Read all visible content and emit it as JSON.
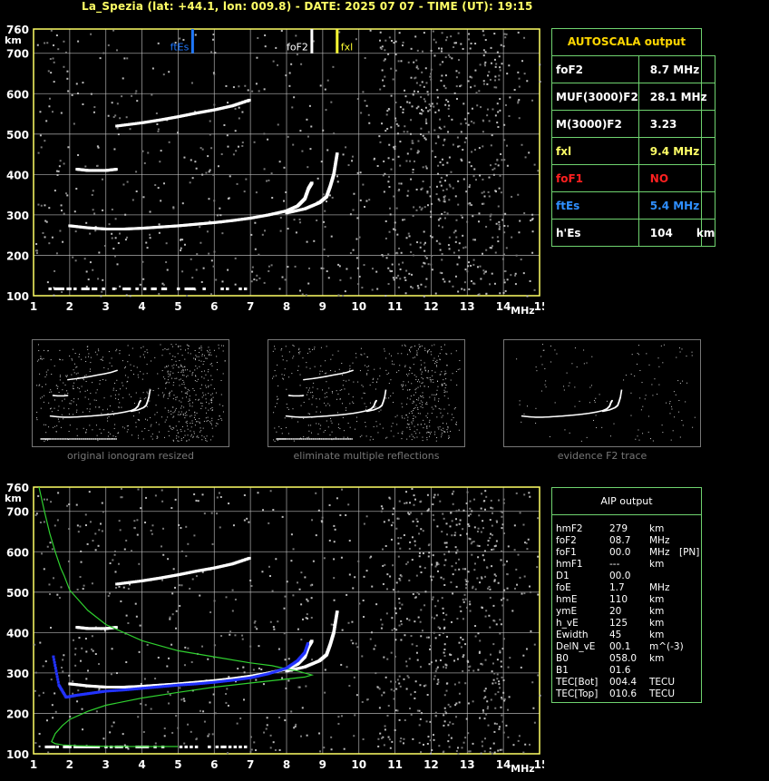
{
  "header": {
    "title": "La_Spezia (lat: +44.1, lon: 009.8) - DATE: 2025 07 07 - TIME (UT): 19:15"
  },
  "axis": {
    "y_unit": "km",
    "x_unit": "MHz",
    "y_ticks": [
      "760",
      "700",
      "600",
      "500",
      "400",
      "300",
      "200",
      "100"
    ],
    "x_ticks": [
      "1",
      "2",
      "3",
      "4",
      "5",
      "6",
      "7",
      "8",
      "9",
      "10",
      "11",
      "12",
      "13",
      "14",
      "15"
    ]
  },
  "markers": {
    "ftEs_label": "ftEs",
    "foF2_label": "foF2",
    "fxl_label": "fxl"
  },
  "autoscala": {
    "title": "AUTOSCALA output",
    "rows": [
      {
        "label": "foF2",
        "value": "8.7 MHz",
        "color": "#ffffff"
      },
      {
        "label": "MUF(3000)F2",
        "value": "28.1 MHz",
        "color": "#ffffff"
      },
      {
        "label": "M(3000)F2",
        "value": "3.23",
        "color": "#ffffff"
      },
      {
        "label": "fxl",
        "value": "9.4 MHz",
        "color": "#ffff66"
      },
      {
        "label": "foF1",
        "value": "NO",
        "color": "#ff2020"
      },
      {
        "label": "ftEs",
        "value": "5.4 MHz",
        "color": "#2f8fff"
      },
      {
        "label": "h'Es",
        "value": "104",
        "unit": "km",
        "color": "#ffffff"
      }
    ]
  },
  "thumbnails": [
    {
      "caption": "original ionogram resized"
    },
    {
      "caption": "eliminate multiple reflections"
    },
    {
      "caption": "evidence F2 trace"
    }
  ],
  "aip": {
    "title": "AIP output",
    "rows": [
      {
        "name": "hmF2",
        "value": "279",
        "unit": "km",
        "extra": ""
      },
      {
        "name": "foF2",
        "value": "08.7",
        "unit": "MHz",
        "extra": ""
      },
      {
        "name": "foF1",
        "value": "00.0",
        "unit": "MHz",
        "extra": "[PN]"
      },
      {
        "name": "hmF1",
        "value": "---",
        "unit": "km",
        "extra": ""
      },
      {
        "name": "D1",
        "value": "00.0",
        "unit": "",
        "extra": ""
      },
      {
        "name": "foE",
        "value": "1.7",
        "unit": "MHz",
        "extra": ""
      },
      {
        "name": "hmE",
        "value": "110",
        "unit": "km",
        "extra": ""
      },
      {
        "name": "ymE",
        "value": "20",
        "unit": "km",
        "extra": ""
      },
      {
        "name": "h_vE",
        "value": "125",
        "unit": "km",
        "extra": ""
      },
      {
        "name": "Ewidth",
        "value": "45",
        "unit": "km",
        "extra": ""
      },
      {
        "name": "DelN_vE",
        "value": "00.1",
        "unit": "m^(-3)",
        "extra": ""
      },
      {
        "name": "B0",
        "value": "058.0",
        "unit": "km",
        "extra": ""
      },
      {
        "name": "B1",
        "value": "01.6",
        "unit": "",
        "extra": ""
      },
      {
        "name": "TEC[Bot]",
        "value": "004.4",
        "unit": "TECU",
        "extra": ""
      },
      {
        "name": "TEC[Top]",
        "value": "010.6",
        "unit": "TECU",
        "extra": ""
      }
    ]
  },
  "colors": {
    "grid": "#c8c8c8",
    "axis": "#ffff66",
    "ftEs": "#1f78ff",
    "fxl": "#ffff33",
    "profile": "#2fd02f",
    "fit": "#2233ff",
    "panel_border": "#6fd36f"
  },
  "chart_data": [
    {
      "type": "scatter",
      "title": "",
      "xlabel": "MHz",
      "ylabel": "km",
      "xlim": [
        1,
        15
      ],
      "ylim": [
        100,
        760
      ],
      "grid": true,
      "series": [
        {
          "name": "",
          "x": [
            2.0,
            2.5,
            3.0,
            3.5,
            4.0,
            4.5,
            5.0,
            5.5,
            6.0,
            6.5,
            7.0,
            7.5,
            8.0,
            8.3,
            8.5,
            8.6,
            8.7
          ],
          "y": [
            273,
            268,
            265,
            265,
            267,
            270,
            273,
            277,
            281,
            286,
            292,
            300,
            310,
            322,
            340,
            365,
            380
          ]
        },
        {
          "name": "",
          "x": [
            8.0,
            8.5,
            8.9,
            9.1,
            9.2,
            9.3,
            9.4
          ],
          "y": [
            305,
            315,
            330,
            345,
            370,
            400,
            455
          ]
        },
        {
          "name": "",
          "x": [
            3.3,
            4.0,
            4.5,
            5.0,
            5.5,
            6.0,
            6.5,
            7.0
          ],
          "y": [
            520,
            528,
            535,
            543,
            552,
            560,
            570,
            585
          ]
        },
        {
          "name": "",
          "x": [
            2.2,
            2.5,
            3.0,
            3.3
          ],
          "y": [
            413,
            410,
            410,
            413
          ]
        },
        {
          "name": "",
          "x": [
            1.3,
            2.0,
            3.0,
            4.0,
            5.0,
            6.0,
            7.0
          ],
          "y": [
            117,
            117,
            117,
            117,
            117,
            117,
            117
          ]
        }
      ],
      "markers": [
        {
          "label": "ftEs",
          "x": 5.4
        },
        {
          "label": "foF2",
          "x": 8.7
        },
        {
          "label": "fxl",
          "x": 9.4
        }
      ]
    },
    {
      "type": "line",
      "title": "",
      "xlabel": "MHz",
      "ylabel": "km",
      "xlim": [
        1,
        15
      ],
      "ylim": [
        100,
        760
      ],
      "grid": true,
      "series": [
        {
          "name": "",
          "x": [
            1.15,
            1.3,
            1.45,
            1.6,
            1.75,
            1.85,
            2.0,
            2.5,
            3.0,
            4.0,
            5.0,
            6.0,
            7.0,
            7.6,
            8.0,
            8.3,
            8.5,
            8.7,
            8.5,
            8.0,
            7.0,
            6.0,
            5.0,
            4.0,
            3.0,
            2.5,
            2.0,
            1.8,
            1.6,
            1.5,
            1.6,
            1.8,
            2.2,
            2.6,
            3.2,
            3.8,
            4.5,
            5.0
          ],
          "y": [
            760,
            700,
            645,
            600,
            560,
            540,
            505,
            455,
            420,
            380,
            355,
            340,
            325,
            318,
            310,
            305,
            300,
            295,
            290,
            285,
            275,
            265,
            252,
            238,
            220,
            205,
            185,
            170,
            150,
            130,
            125,
            122,
            120,
            119,
            118,
            118,
            118,
            118
          ]
        },
        {
          "name": "",
          "x": [
            1.55,
            1.7,
            1.9,
            2.2,
            2.6,
            3.0,
            3.5,
            4.0,
            4.5,
            5.0,
            5.5,
            6.0,
            6.5,
            7.0,
            7.5,
            8.0,
            8.3,
            8.5,
            8.6
          ],
          "y": [
            340,
            270,
            240,
            245,
            250,
            255,
            258,
            262,
            266,
            270,
            273,
            277,
            282,
            288,
            298,
            312,
            330,
            350,
            375
          ]
        }
      ]
    }
  ]
}
